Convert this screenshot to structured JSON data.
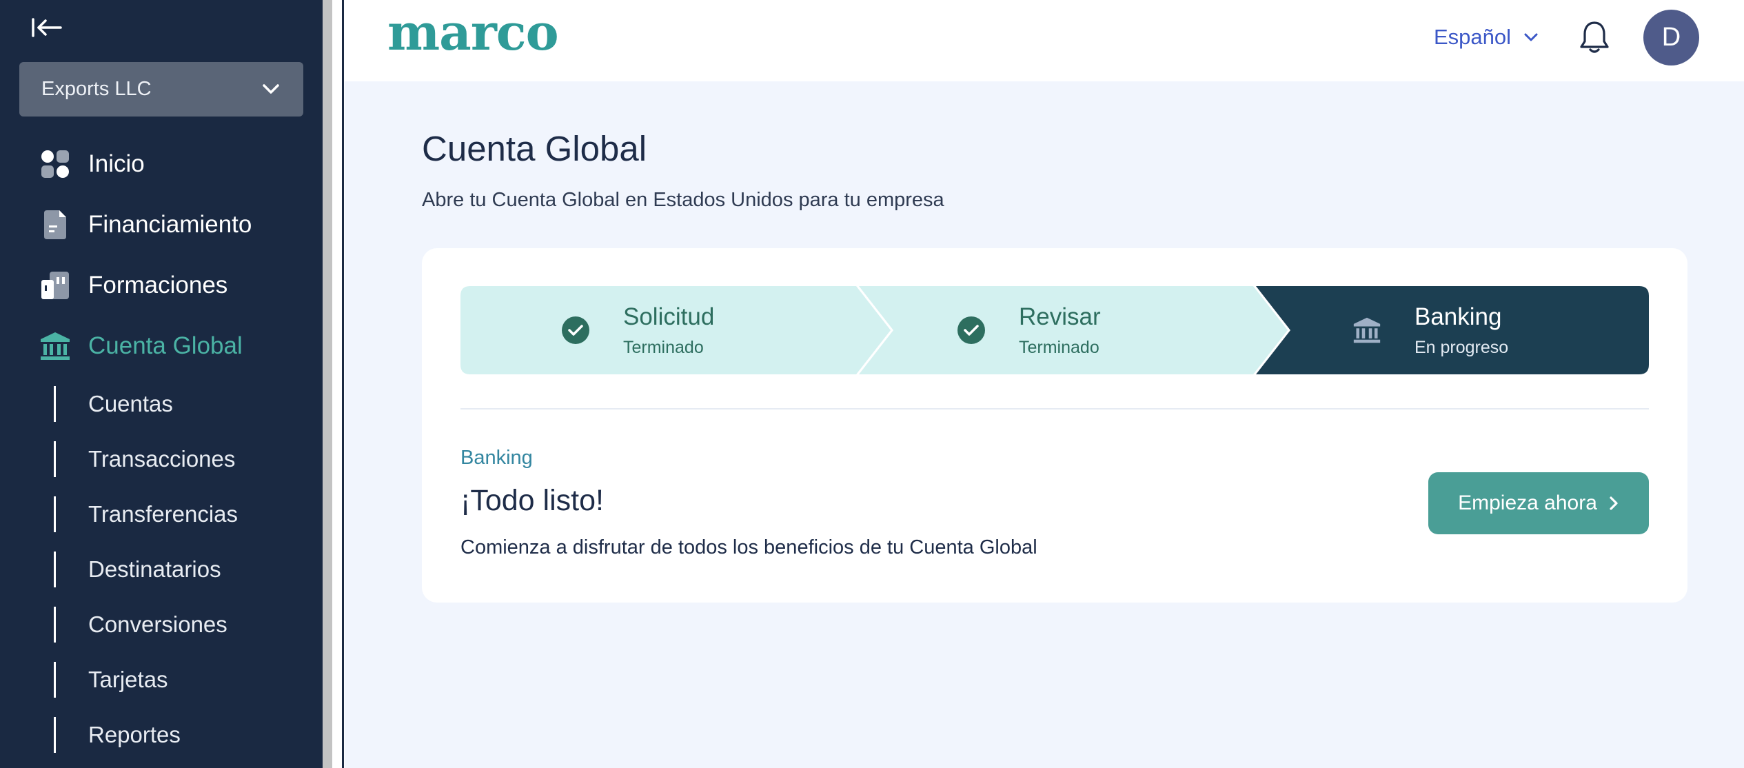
{
  "sidebar": {
    "org": "Exports LLC",
    "nav": [
      {
        "label": "Inicio"
      },
      {
        "label": "Financiamiento"
      },
      {
        "label": "Formaciones"
      },
      {
        "label": "Cuenta Global"
      }
    ],
    "sub": [
      {
        "label": "Cuentas"
      },
      {
        "label": "Transacciones"
      },
      {
        "label": "Transferencias"
      },
      {
        "label": "Destinatarios"
      },
      {
        "label": "Conversiones"
      },
      {
        "label": "Tarjetas"
      },
      {
        "label": "Reportes"
      }
    ]
  },
  "header": {
    "logo": "marco",
    "language": "Español",
    "avatar_initial": "D"
  },
  "page": {
    "title": "Cuenta Global",
    "subtitle": "Abre tu Cuenta Global en Estados Unidos para tu empresa"
  },
  "stepper": [
    {
      "label": "Solicitud",
      "status": "Terminado"
    },
    {
      "label": "Revisar",
      "status": "Terminado"
    },
    {
      "label": "Banking",
      "status": "En progreso"
    }
  ],
  "section": {
    "tag": "Banking",
    "title": "¡Todo listo!",
    "description": "Comienza a disfrutar de todos los beneficios de tu Cuenta Global",
    "cta": "Empieza ahora"
  },
  "colors": {
    "sidebar_bg": "#1a2942",
    "accent": "#4bb3a5",
    "step_done_bg": "#d3f1f0",
    "step_active_bg": "#1c3f52",
    "cta_bg": "#4a9e96",
    "link_blue": "#3b57c7"
  }
}
